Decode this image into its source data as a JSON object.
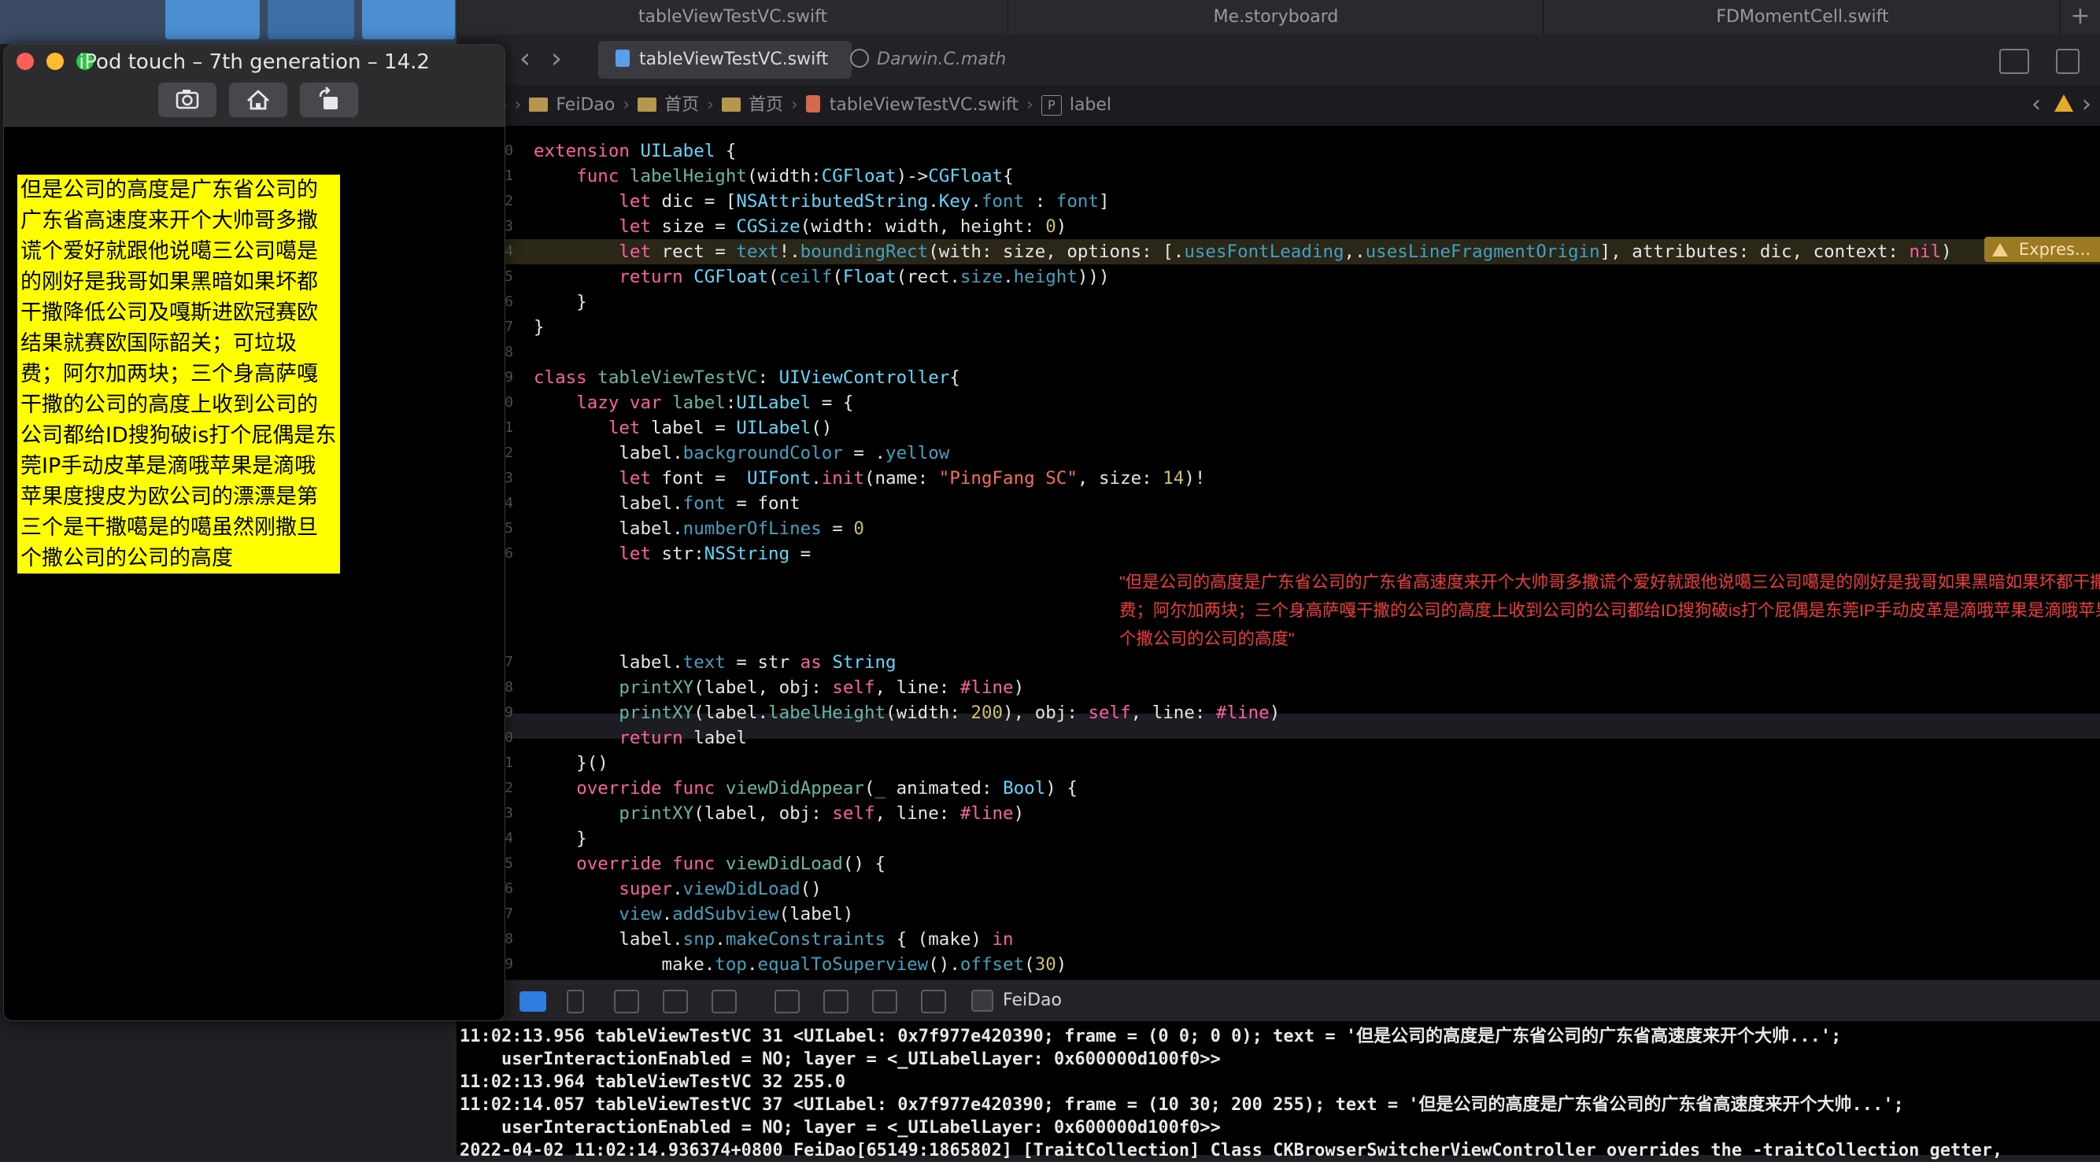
{
  "file_tabs": [
    "tableViewTestVC.swift",
    "Me.storyboard",
    "FDMomentCell.swift"
  ],
  "file_tab_add": "+",
  "editor_tabs": {
    "active": "tableViewTestVC.swift",
    "inactive": "Darwin.C.math"
  },
  "jump_bar": {
    "crumbs": [
      "eiDao",
      "FeiDao",
      "首页",
      "首页",
      "tableViewTestVC.swift"
    ],
    "symbol_badge": "P",
    "symbol": "label"
  },
  "gutter_numbers": [
    "0",
    "1",
    "2",
    "3",
    "4",
    "5",
    "6",
    "7",
    "8",
    "9",
    "0",
    "1",
    "2",
    "3",
    "4",
    "5",
    "6",
    "7",
    "8",
    "9",
    "0",
    "1",
    "2",
    "3",
    "4",
    "5",
    "6",
    "7",
    "8",
    "9",
    "0",
    "1",
    "2",
    "3",
    "4",
    "5"
  ],
  "warning_badge": "Expres...",
  "string_literal": "\"但是公司的高度是广东省公司的广东省高速度来开个大帅哥多撒谎个爱好就跟他说噶三公司噶是的刚好是我哥如果黑暗如果坏都干撒降低公司及嘎斯进欧冠赛欧结果就赛欧国际韶关；可垃圾费；阿尔加两块；三个身高萨嘎干撒的公司的高度上收到公司的公司都给ID搜狗破is打个屁偶是东莞IP手动皮革是滴哦苹果是滴哦苹果度搜皮为欧公司的漂漂是第三个是干撒噶是的噶虽然刚撒旦个撒公司的公司的高度\"",
  "debug_bar": {
    "scheme": "FeiDao"
  },
  "console_lines": [
    "11:02:13.956 tableViewTestVC 31 <UILabel: 0x7f977e420390; frame = (0 0; 0 0); text = '但是公司的高度是广东省公司的广东省高速度来开个大帅...';",
    "    userInteractionEnabled = NO; layer = <_UILabelLayer: 0x600000d100f0>>",
    "11:02:13.964 tableViewTestVC 32 255.0",
    "11:02:14.057 tableViewTestVC 37 <UILabel: 0x7f977e420390; frame = (10 30; 200 255); text = '但是公司的高度是广东省公司的广东省高速度来开个大帅...';",
    "    userInteractionEnabled = NO; layer = <_UILabelLayer: 0x600000d100f0>>",
    "2022-04-02 11:02:14.936374+0800 FeiDao[65149:1865802] [TraitCollection] Class CKBrowserSwitcherViewController overrides the -traitCollection getter,"
  ],
  "simulator": {
    "title": "iPod touch – 7th generation – 14.2",
    "label_text": "但是公司的高度是广东省公司的广东省高速度来开个大帅哥多撒谎个爱好就跟他说噶三公司噶是的刚好是我哥如果黑暗如果坏都干撒降低公司及嘎斯进欧冠赛欧结果就赛欧国际韶关；可垃圾费；阿尔加两块；三个身高萨嘎干撒的公司的高度上收到公司的公司都给ID搜狗破is打个屁偶是东莞IP手动皮革是滴哦苹果是滴哦苹果度搜皮为欧公司的漂漂是第三个是干撒噶是的噶虽然刚撒旦个撒公司的公司的高度"
  },
  "colors": {
    "label_background": "#ffff00",
    "keyword": "#fc5fa3",
    "type": "#5dd8ff",
    "string": "#fc6a5d",
    "warning": "#e5a92d"
  },
  "icons": [
    "screenshot-icon",
    "home-icon",
    "rotate-icon",
    "swift-file-icon",
    "folder-icon",
    "warning-icon"
  ]
}
